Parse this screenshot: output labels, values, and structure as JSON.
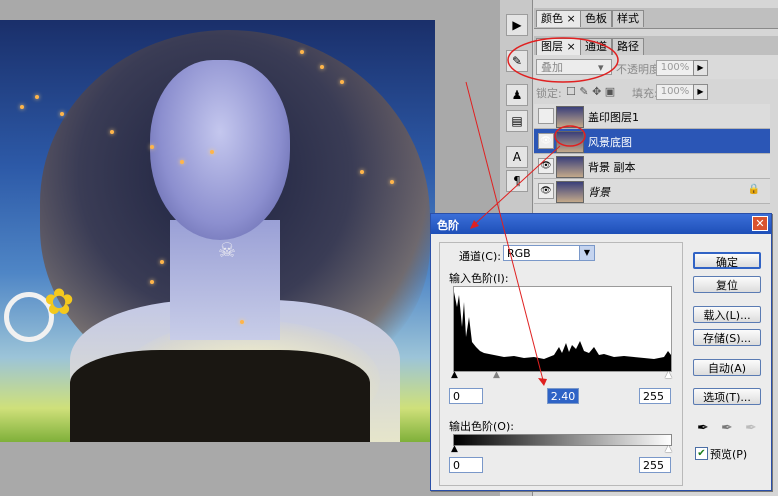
{
  "top_panel": {
    "tabs": [
      "颜色",
      "色板",
      "样式"
    ]
  },
  "layers_panel": {
    "tabs": [
      "图层",
      "通道",
      "路径"
    ],
    "blend_mode": "叠加",
    "opacity_label": "不透明度:",
    "opacity_value": "100%",
    "lock_label": "锁定:",
    "fill_label": "填充:",
    "fill_value": "100%",
    "layers": [
      {
        "name": "盖印图层1",
        "visible": false,
        "selected": false,
        "locked": false
      },
      {
        "name": "风景底图",
        "visible": true,
        "selected": true,
        "locked": false
      },
      {
        "name": "背景 副本",
        "visible": true,
        "selected": false,
        "locked": false
      },
      {
        "name": "背景",
        "visible": true,
        "selected": false,
        "locked": true
      }
    ],
    "lock_icon": "lock-icon"
  },
  "levels_dialog": {
    "title": "色阶",
    "close": "✕",
    "channel_label": "通道(C):",
    "channel_value": "RGB",
    "input_label": "输入色阶(I):",
    "input_black": "0",
    "input_gamma": "2.40",
    "input_white": "255",
    "output_label": "输出色阶(O):",
    "output_black": "0",
    "output_white": "255",
    "buttons": {
      "ok": "确定",
      "reset": "复位",
      "load": "载入(L)...",
      "save": "存储(S)...",
      "auto": "自动(A)",
      "options": "选项(T)..."
    },
    "preview_label": "预览(P)",
    "preview_checked": true
  },
  "colors": {
    "selection": "#2b56b6",
    "titlebar": "#1e4fb8",
    "annotation": "#e02020"
  }
}
